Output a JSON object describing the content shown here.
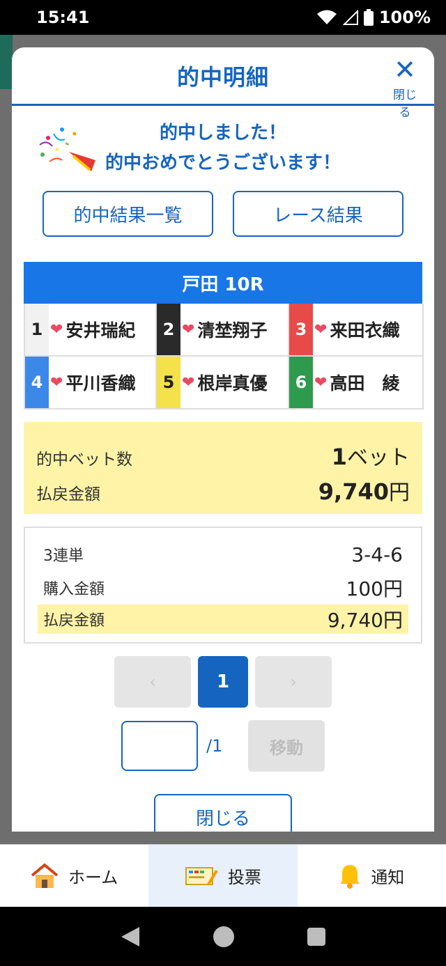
{
  "status": {
    "time": "15:41",
    "battery": "100%"
  },
  "modal": {
    "title": "的中明細",
    "close_label": "閉じる",
    "congrats_line1": "的中しました！",
    "congrats_line2": "的中おめでとうございます！",
    "btn_results_list": "的中結果一覧",
    "btn_race_result": "レース結果"
  },
  "race": {
    "title": "戸田 10R",
    "racers": [
      {
        "num": "1",
        "name": "安井瑞紀"
      },
      {
        "num": "2",
        "name": "清埜翔子"
      },
      {
        "num": "3",
        "name": "来田衣織"
      },
      {
        "num": "4",
        "name": "平川香織"
      },
      {
        "num": "5",
        "name": "根岸真優"
      },
      {
        "num": "6",
        "name": "高田　綾"
      }
    ]
  },
  "summary": {
    "bet_count_label": "的中ベット数",
    "bet_count_num": "1",
    "bet_count_unit": "ベット",
    "payout_label": "払戻金額",
    "payout_num": "9,740",
    "payout_unit": "円"
  },
  "detail": {
    "bet_type": "3連単",
    "combination": "3-4-6",
    "purchase_label": "購入金額",
    "purchase_value": "100円",
    "payout_label": "払戻金額",
    "payout_value": "9,740円"
  },
  "pager": {
    "prev": "‹",
    "current": "1",
    "next": "›"
  },
  "jump": {
    "total": "/1",
    "move_label": "移動"
  },
  "close_button": "閉じる",
  "tabs": {
    "home": "ホーム",
    "vote": "投票",
    "notify": "通知"
  }
}
